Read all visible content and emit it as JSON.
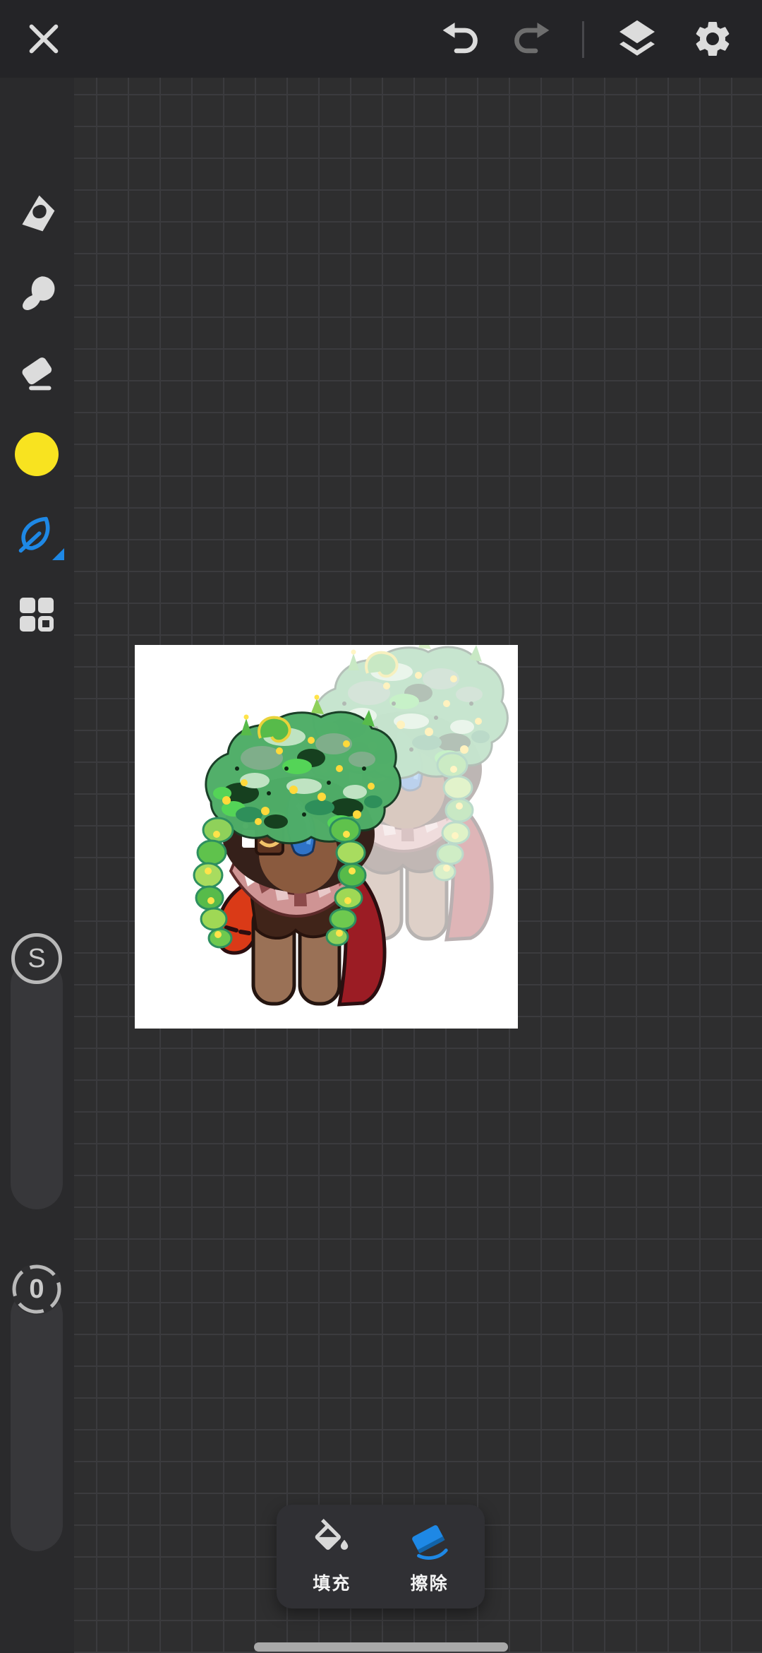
{
  "colors": {
    "accent_blue": "#1e88e5",
    "swatch_yellow": "#f8e320",
    "topbar_bg": "#242427",
    "sidebar_bg": "#2a2a2c",
    "canvas_bg": "#2e2e2f",
    "grid_line": "#3b3b3e",
    "panel_bg": "#303034",
    "icon_light": "#dcdcdc",
    "icon_dim": "#6e6e6e",
    "home_indicator": "#a9a9a9",
    "canvas_paper": "#ffffff"
  },
  "topbar": {
    "buttons": [
      "close",
      "undo",
      "redo",
      "layers",
      "settings"
    ],
    "redo_enabled": false
  },
  "sidebar": {
    "tools": [
      {
        "name": "brush"
      },
      {
        "name": "smudge"
      },
      {
        "name": "eraser"
      },
      {
        "name": "color-swatch",
        "color": "#f8e320"
      },
      {
        "name": "leaf-brush",
        "selected": true
      },
      {
        "name": "blocks"
      }
    ],
    "sliders": [
      {
        "label": "S",
        "name": "brush-size"
      },
      {
        "label": "0",
        "name": "opacity"
      }
    ]
  },
  "bottom_panel": {
    "buttons": [
      {
        "label": "填充",
        "name": "fill",
        "active": false
      },
      {
        "label": "擦除",
        "name": "erase",
        "active": true
      }
    ]
  },
  "artwork": {
    "palette": [
      "#4fae68",
      "#16401f",
      "#bfe3c2",
      "#54d457",
      "#2e8f5a",
      "#ffd93b",
      "#8a5a3e",
      "#35201a",
      "#2f73c8",
      "#cf9494",
      "#9b1c24",
      "#da3a17",
      "#9a7156",
      "#402419"
    ],
    "ghost_copy_opacity": 0.32
  }
}
